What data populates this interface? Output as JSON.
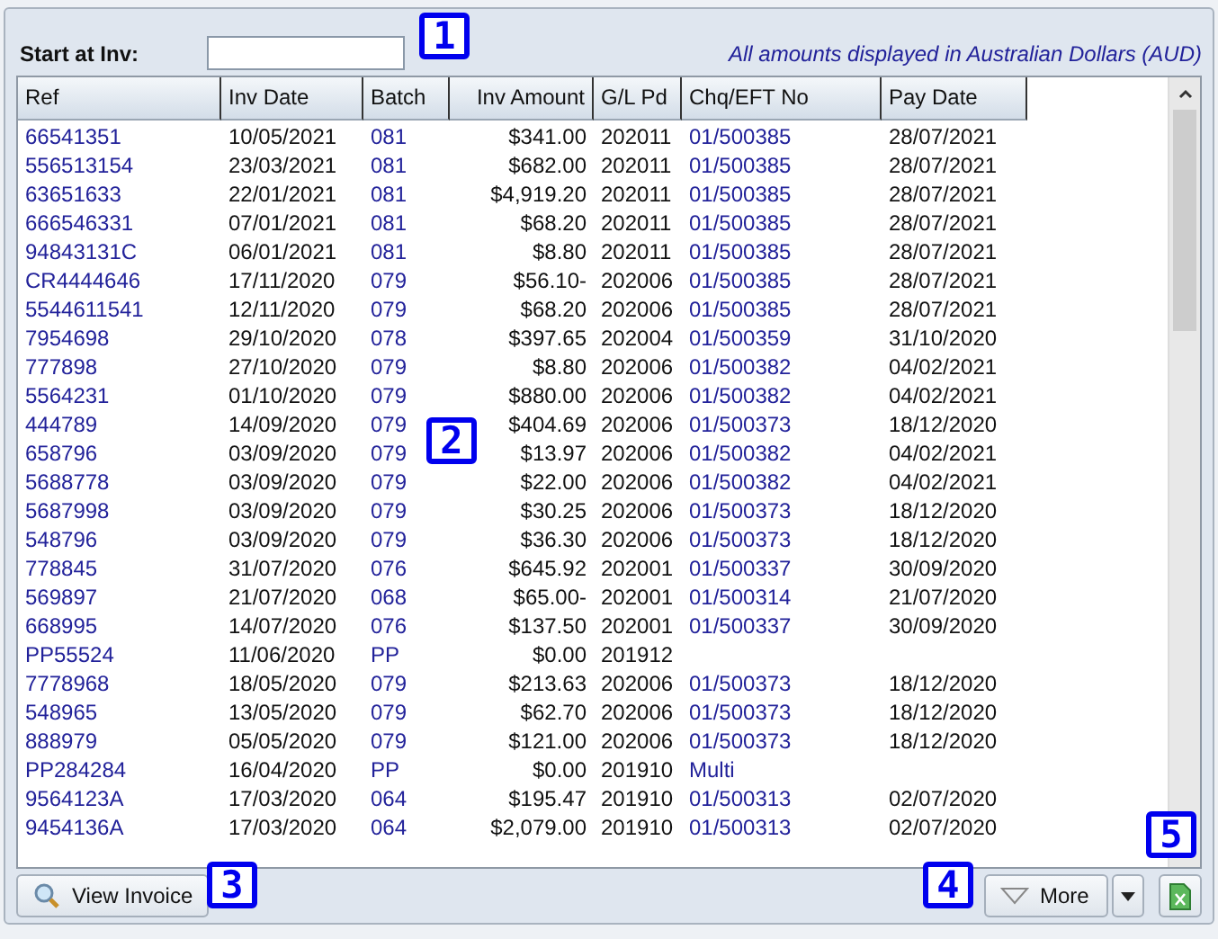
{
  "filter": {
    "label": "Start at Inv:"
  },
  "currency_note": "All amounts displayed in Australian Dollars (AUD)",
  "table": {
    "columns": [
      {
        "label": "Ref",
        "kind": "link"
      },
      {
        "label": "Inv Date",
        "kind": "text"
      },
      {
        "label": "Batch",
        "kind": "link"
      },
      {
        "label": "Inv Amount",
        "kind": "amount"
      },
      {
        "label": "G/L Pd",
        "kind": "text"
      },
      {
        "label": "Chq/EFT No",
        "kind": "link"
      },
      {
        "label": "Pay Date",
        "kind": "text"
      }
    ],
    "rows": [
      [
        "66541351",
        "10/05/2021",
        "081",
        "$341.00",
        "202011",
        "01/500385",
        "28/07/2021"
      ],
      [
        "556513154",
        "23/03/2021",
        "081",
        "$682.00",
        "202011",
        "01/500385",
        "28/07/2021"
      ],
      [
        "63651633",
        "22/01/2021",
        "081",
        "$4,919.20",
        "202011",
        "01/500385",
        "28/07/2021"
      ],
      [
        "666546331",
        "07/01/2021",
        "081",
        "$68.20",
        "202011",
        "01/500385",
        "28/07/2021"
      ],
      [
        "94843131C",
        "06/01/2021",
        "081",
        "$8.80",
        "202011",
        "01/500385",
        "28/07/2021"
      ],
      [
        "CR4444646",
        "17/11/2020",
        "079",
        "$56.10-",
        "202006",
        "01/500385",
        "28/07/2021"
      ],
      [
        "5544611541",
        "12/11/2020",
        "079",
        "$68.20",
        "202006",
        "01/500385",
        "28/07/2021"
      ],
      [
        "7954698",
        "29/10/2020",
        "078",
        "$397.65",
        "202004",
        "01/500359",
        "31/10/2020"
      ],
      [
        "777898",
        "27/10/2020",
        "079",
        "$8.80",
        "202006",
        "01/500382",
        "04/02/2021"
      ],
      [
        "5564231",
        "01/10/2020",
        "079",
        "$880.00",
        "202006",
        "01/500382",
        "04/02/2021"
      ],
      [
        "444789",
        "14/09/2020",
        "079",
        "$404.69",
        "202006",
        "01/500373",
        "18/12/2020"
      ],
      [
        "658796",
        "03/09/2020",
        "079",
        "$13.97",
        "202006",
        "01/500382",
        "04/02/2021"
      ],
      [
        "5688778",
        "03/09/2020",
        "079",
        "$22.00",
        "202006",
        "01/500382",
        "04/02/2021"
      ],
      [
        "5687998",
        "03/09/2020",
        "079",
        "$30.25",
        "202006",
        "01/500373",
        "18/12/2020"
      ],
      [
        "548796",
        "03/09/2020",
        "079",
        "$36.30",
        "202006",
        "01/500373",
        "18/12/2020"
      ],
      [
        "778845",
        "31/07/2020",
        "076",
        "$645.92",
        "202001",
        "01/500337",
        "30/09/2020"
      ],
      [
        "569897",
        "21/07/2020",
        "068",
        "$65.00-",
        "202001",
        "01/500314",
        "21/07/2020"
      ],
      [
        "668995",
        "14/07/2020",
        "076",
        "$137.50",
        "202001",
        "01/500337",
        "30/09/2020"
      ],
      [
        "PP55524",
        "11/06/2020",
        "PP",
        "$0.00",
        "201912",
        null,
        null
      ],
      [
        "7778968",
        "18/05/2020",
        "079",
        "$213.63",
        "202006",
        "01/500373",
        "18/12/2020"
      ],
      [
        "548965",
        "13/05/2020",
        "079",
        "$62.70",
        "202006",
        "01/500373",
        "18/12/2020"
      ],
      [
        "888979",
        "05/05/2020",
        "079",
        "$121.00",
        "202006",
        "01/500373",
        "18/12/2020"
      ],
      [
        "PP284284",
        "16/04/2020",
        "PP",
        "$0.00",
        "201910",
        "Multi",
        null
      ],
      [
        "9564123A",
        "17/03/2020",
        "064",
        "$195.47",
        "201910",
        "01/500313",
        "02/07/2020"
      ],
      [
        "9454136A",
        "17/03/2020",
        "064",
        "$2,079.00",
        "201910",
        "01/500313",
        "02/07/2020"
      ]
    ]
  },
  "buttons": {
    "view": "View Invoice",
    "more": "More"
  },
  "callouts": [
    {
      "label": "1"
    },
    {
      "label": "2"
    },
    {
      "label": "3"
    },
    {
      "label": "4"
    },
    {
      "label": "5"
    }
  ]
}
